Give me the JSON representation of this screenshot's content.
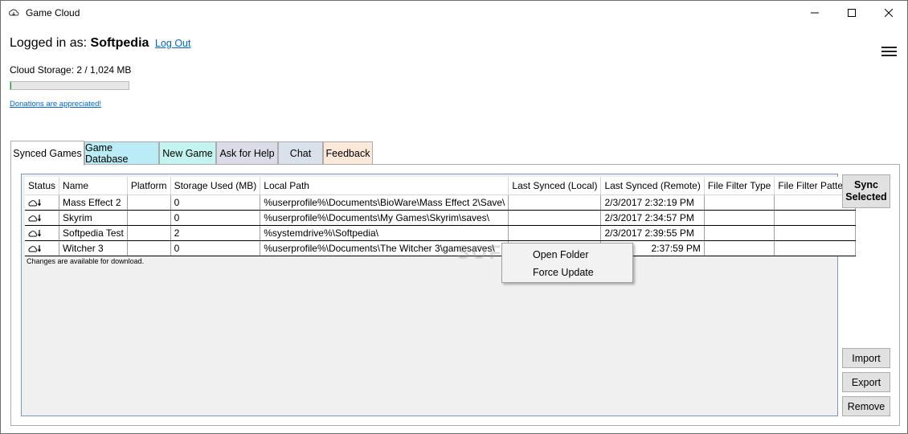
{
  "window": {
    "title": "Game Cloud"
  },
  "account": {
    "logged_in_prefix": "Logged in as:",
    "username": "Softpedia",
    "logout_label": "Log Out"
  },
  "storage": {
    "label": "Cloud Storage: 2 / 1,024 MB",
    "used_fraction": 0.002
  },
  "donation": {
    "label": "Donations are appreciated!"
  },
  "tabs": [
    {
      "label": "Synced Games",
      "active": true,
      "color": "#ffffff"
    },
    {
      "label": "Game Database",
      "active": false,
      "color": "#b9ecf4"
    },
    {
      "label": "New Game",
      "active": false,
      "color": "#c4f4ef"
    },
    {
      "label": "Ask for Help",
      "active": false,
      "color": "#dcdbe8"
    },
    {
      "label": "Chat",
      "active": false,
      "color": "#d9e2ea"
    },
    {
      "label": "Feedback",
      "active": false,
      "color": "#fce9d9"
    }
  ],
  "table": {
    "headers": [
      "Status",
      "Name",
      "Platform",
      "Storage Used (MB)",
      "Local Path",
      "Last Synced (Local)",
      "Last Synced (Remote)",
      "File Filter Type",
      "File Filter Pattern"
    ],
    "rows": [
      {
        "name": "Mass Effect 2",
        "platform": "",
        "storage": "0",
        "path": "%userprofile%\\Documents\\BioWare\\Mass Effect 2\\Save\\",
        "local": "",
        "remote": "2/3/2017 2:32:19 PM",
        "filter_type": "",
        "filter_pattern": ""
      },
      {
        "name": "Skyrim",
        "platform": "",
        "storage": "0",
        "path": "%userprofile%\\Documents\\My Games\\Skyrim\\saves\\",
        "local": "",
        "remote": "2/3/2017 2:34:57 PM",
        "filter_type": "",
        "filter_pattern": ""
      },
      {
        "name": "Softpedia Test",
        "platform": "",
        "storage": "2",
        "path": "%systemdrive%\\Softpedia\\",
        "local": "",
        "remote": "2/3/2017 2:39:55 PM",
        "filter_type": "",
        "filter_pattern": ""
      },
      {
        "name": "Witcher 3",
        "platform": "",
        "storage": "0",
        "path": "%userprofile%\\Documents\\The Witcher 3\\gamesaves\\",
        "local": "",
        "remote": "2:37:59 PM",
        "filter_type": "",
        "filter_pattern": ""
      }
    ],
    "status_note": "Changes are available for download."
  },
  "buttons": {
    "sync_line1": "Sync",
    "sync_line2": "Selected",
    "import": "Import",
    "export": "Export",
    "remove": "Remove"
  },
  "context_menu": {
    "items": [
      "Open Folder",
      "Force Update"
    ]
  },
  "watermark": "SOFTPEDIA",
  "colors": {
    "link": "#0066cc",
    "progress": "#06b025",
    "grid_border": "#7a9bbd"
  }
}
